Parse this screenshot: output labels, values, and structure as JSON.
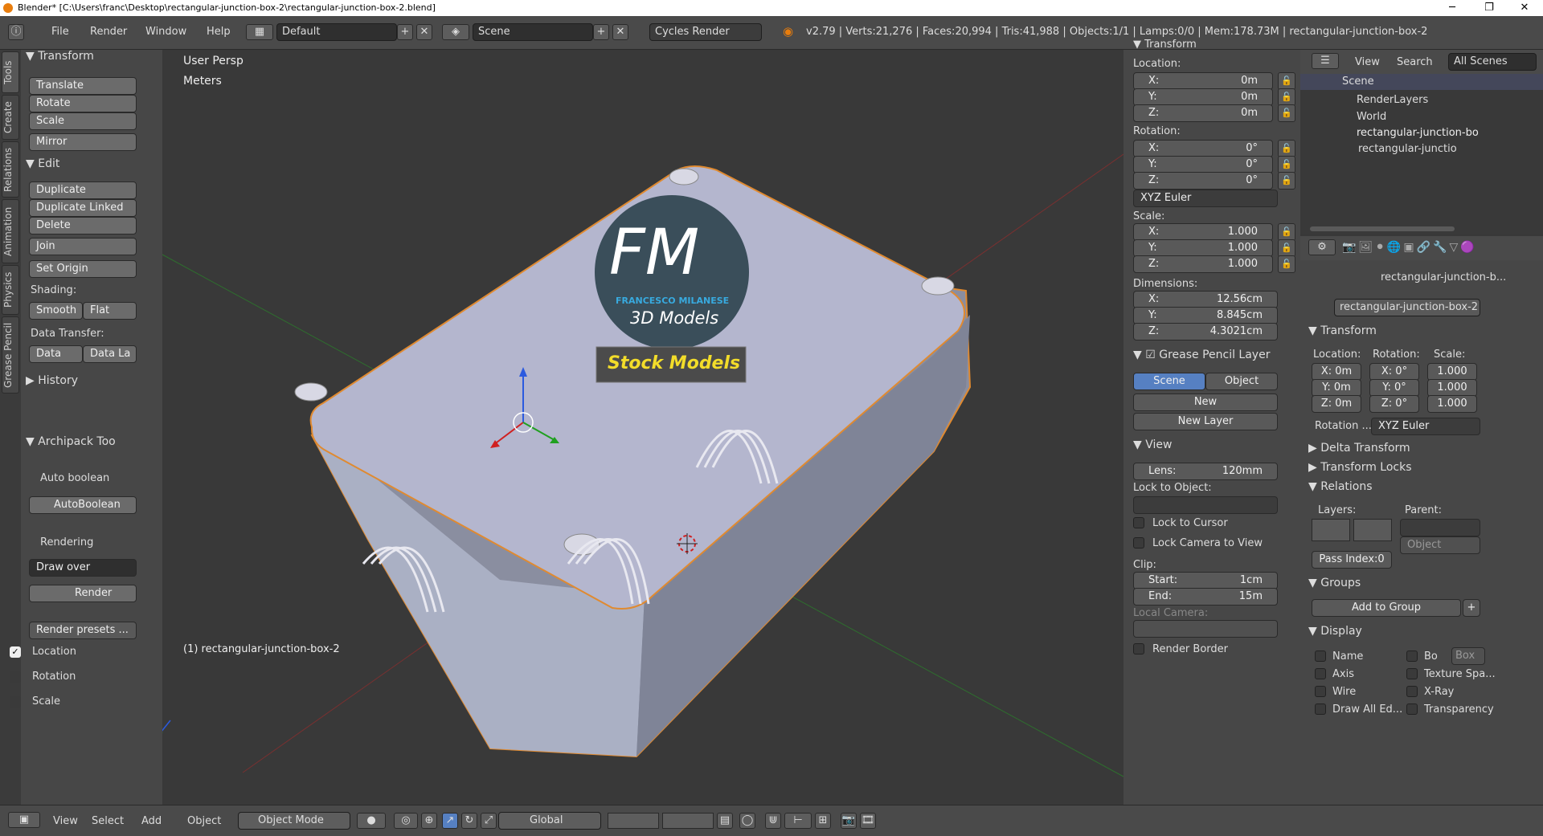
{
  "window": {
    "title": "Blender* [C:\\Users\\franc\\Desktop\\rectangular-junction-box-2\\rectangular-junction-box-2.blend]"
  },
  "info": {
    "menus": [
      "File",
      "Render",
      "Window",
      "Help"
    ],
    "layout": "Default",
    "scene": "Scene",
    "engine": "Cycles Render",
    "stats": "v2.79 | Verts:21,276 | Faces:20,994 | Tris:41,988 | Objects:1/1 | Lamps:0/0 | Mem:178.73M | rectangular-junction-box-2"
  },
  "tabs": [
    "Tools",
    "Create",
    "Relations",
    "Animation",
    "Physics",
    "Grease Pencil"
  ],
  "toolshelf": {
    "transform_header": "Transform",
    "translate": "Translate",
    "rotate": "Rotate",
    "scale": "Scale",
    "mirror": "Mirror",
    "edit_header": "Edit",
    "duplicate": "Duplicate",
    "duplicate_linked": "Duplicate Linked",
    "delete": "Delete",
    "join": "Join",
    "set_origin": "Set Origin",
    "shading_label": "Shading:",
    "smooth": "Smooth",
    "flat": "Flat",
    "data_transfer_label": "Data Transfer:",
    "data": "Data",
    "data_la": "Data La",
    "history_header": "History",
    "archipack_header": "Archipack Too",
    "auto_boolean_label": "Auto boolean",
    "autoboolean": "AutoBoolean",
    "rendering_label": "Rendering",
    "draw_over": "Draw over",
    "render": "Render",
    "render_presets": "Render presets ...",
    "location": "Location",
    "rotation": "Rotation",
    "scale_opt": "Scale"
  },
  "viewport": {
    "view_name": "User Persp",
    "units": "Meters",
    "object_label": "(1) rectangular-junction-box-2",
    "logo_title": "FM",
    "logo_sub": "FRANCESCO MILANESE",
    "logo_models": "3D Models",
    "logo_stock": "Stock Models"
  },
  "npanel": {
    "transform": "Transform",
    "location": "Location:",
    "loc": [
      {
        "k": "X:",
        "v": "0m"
      },
      {
        "k": "Y:",
        "v": "0m"
      },
      {
        "k": "Z:",
        "v": "0m"
      }
    ],
    "rotation": "Rotation:",
    "rot": [
      {
        "k": "X:",
        "v": "0°"
      },
      {
        "k": "Y:",
        "v": "0°"
      },
      {
        "k": "Z:",
        "v": "0°"
      }
    ],
    "rot_mode": "XYZ Euler",
    "scale": "Scale:",
    "scl": [
      {
        "k": "X:",
        "v": "1.000"
      },
      {
        "k": "Y:",
        "v": "1.000"
      },
      {
        "k": "Z:",
        "v": "1.000"
      }
    ],
    "dimensions": "Dimensions:",
    "dim": [
      {
        "k": "X:",
        "v": "12.56cm"
      },
      {
        "k": "Y:",
        "v": "8.845cm"
      },
      {
        "k": "Z:",
        "v": "4.3021cm"
      }
    ],
    "gp_layer": "Grease Pencil Layer",
    "scene_btn": "Scene",
    "object_btn": "Object",
    "new": "New",
    "new_layer": "New Layer",
    "view": "View",
    "lens_k": "Lens:",
    "lens_v": "120mm",
    "lock_obj": "Lock to Object:",
    "lock_cursor": "Lock to Cursor",
    "lock_cam": "Lock Camera to View",
    "clip": "Clip:",
    "start_k": "Start:",
    "start_v": "1cm",
    "end_k": "End:",
    "end_v": "15m",
    "local_cam": "Local Camera:",
    "render_border": "Render Border"
  },
  "outliner": {
    "view": "View",
    "search": "Search",
    "all_scenes": "All Scenes",
    "items": [
      "Scene",
      "RenderLayers",
      "World",
      "rectangular-junction-bo",
      "rectangular-junctio"
    ]
  },
  "props": {
    "crumb": "rectangular-junction-b...",
    "obj_name": "rectangular-junction-box-2",
    "transform": "Transform",
    "location": "Location:",
    "rotation": "Rotation:",
    "scale": "Scale:",
    "loc": [
      "X: 0m",
      "Y: 0m",
      "Z: 0m"
    ],
    "rot": [
      "X:  0°",
      "Y:  0°",
      "Z:  0°"
    ],
    "scl": [
      "1.000",
      "1.000",
      "1.000"
    ],
    "rot_mode_lbl": "Rotation ...",
    "rot_mode": "XYZ Euler",
    "delta": "Delta Transform",
    "locks": "Transform Locks",
    "relations": "Relations",
    "layers": "Layers:",
    "parent": "Parent:",
    "parent_type": "Object",
    "pass_index": "Pass Index:0",
    "groups": "Groups",
    "add_group": "Add to Group",
    "display": "Display",
    "name": "Name",
    "bo": "Bo",
    "box": "Box",
    "axis": "Axis",
    "texture_space": "Texture Spa...",
    "wire": "Wire",
    "xray": "X-Ray",
    "draw_all": "Draw All Ed...",
    "transparency": "Transparency"
  },
  "bottom": {
    "menus": [
      "View",
      "Select",
      "Add",
      "Object"
    ],
    "mode": "Object Mode",
    "orientation": "Global"
  }
}
